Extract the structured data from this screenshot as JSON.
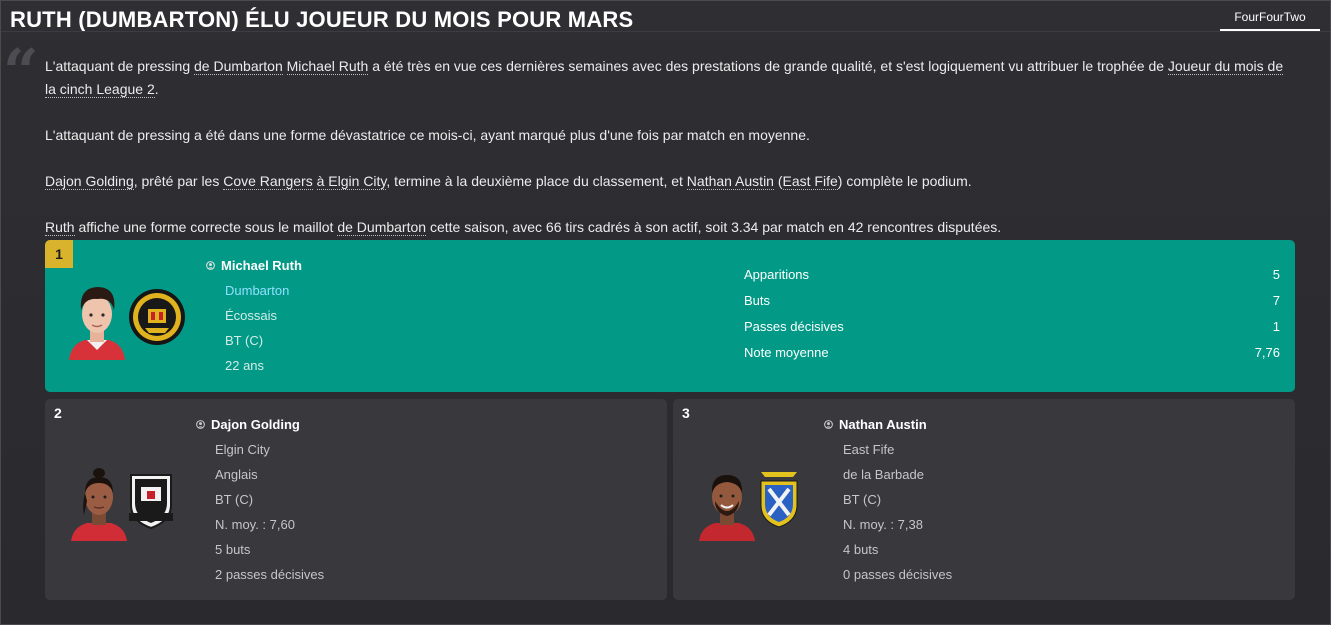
{
  "header": {
    "title": "RUTH (DUMBARTON) ÉLU JOUEUR DU MOIS POUR MARS",
    "source": "FourFourTwo"
  },
  "article": {
    "p1": {
      "a": "L'attaquant de pressing ",
      "club": "de Dumbarton",
      "b": " ",
      "player": "Michael Ruth",
      "c": " a été très en vue ces dernières semaines avec des prestations de grande qualité, et s'est logiquement vu attribuer le trophée de ",
      "award": "Joueur du mois de la cinch League 2",
      "d": "."
    },
    "p2": "L'attaquant de pressing a été dans une forme dévastatrice ce mois-ci, ayant marqué plus d'une fois par match en moyenne.",
    "p3": {
      "player2": "Dajon Golding",
      "a": ", prêté par les ",
      "club_from": "Cove Rangers",
      "b": " ",
      "club_to": "à Elgin City",
      "c": ", termine à la deuxième place du classement, et ",
      "player3": "Nathan Austin",
      "d": " (",
      "club3": "East Fife",
      "e": ") complète le podium."
    },
    "p4": {
      "player": "Ruth",
      "a": " affiche une forme correcte sous le maillot ",
      "club": "de Dumbarton",
      "b": " cette saison, avec 66 tirs cadrés à son actif, soit 3.34 par match en 42 rencontres disputées."
    }
  },
  "winner": {
    "rank": "1",
    "name": "Michael Ruth",
    "club": "Dumbarton",
    "nationality": "Écossais",
    "position": "BT (C)",
    "age": "22 ans",
    "stats": [
      {
        "label": "Apparitions",
        "value": "5"
      },
      {
        "label": "Buts",
        "value": "7"
      },
      {
        "label": "Passes décisives",
        "value": "1"
      },
      {
        "label": "Note moyenne",
        "value": "7,76"
      }
    ]
  },
  "runners": [
    {
      "rank": "2",
      "name": "Dajon Golding",
      "club": "Elgin City",
      "nationality": "Anglais",
      "position": "BT (C)",
      "rating": "N. moy. : 7,60",
      "goals": "5 buts",
      "assists": "2 passes décisives"
    },
    {
      "rank": "3",
      "name": "Nathan Austin",
      "club": "East Fife",
      "nationality": "de la Barbade",
      "position": "BT (C)",
      "rating": "N. moy. : 7,38",
      "goals": "4 buts",
      "assists": "0 passes décisives"
    }
  ],
  "colors": {
    "winner_bg": "#029a86",
    "rank_badge": "#d9b32b",
    "club_link": "#8fe0ff",
    "card_bg": "#38383d"
  },
  "icons": [
    "quote-icon",
    "person-icon"
  ]
}
